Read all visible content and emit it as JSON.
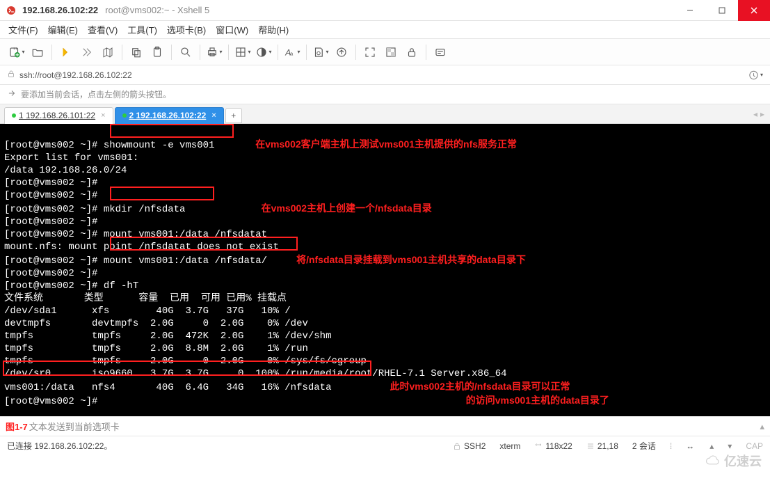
{
  "title": {
    "host": "192.168.26.102:22",
    "session": "root@vms002:~ - Xshell 5"
  },
  "menu": {
    "file": "文件(F)",
    "edit": "编辑(E)",
    "view": "查看(V)",
    "tools": "工具(T)",
    "tabs": "选项卡(B)",
    "window": "窗口(W)",
    "help": "帮助(H)"
  },
  "addr": {
    "url": "ssh://root@192.168.26.102:22"
  },
  "tip": {
    "text": "要添加当前会话，点击左侧的箭头按钮。"
  },
  "tabs": {
    "tab1_label": "1 192.168.26.101:22",
    "tab2_label": "2 192.168.26.102:22",
    "plus": "+"
  },
  "terminal": {
    "lines": [
      "[root@vms002 ~]# showmount -e vms001",
      "Export list for vms001:",
      "/data 192.168.26.0/24",
      "[root@vms002 ~]# ",
      "[root@vms002 ~]# ",
      "[root@vms002 ~]# mkdir /nfsdata",
      "[root@vms002 ~]# ",
      "[root@vms002 ~]# mount vms001:/data /nfsdatat",
      "mount.nfs: mount point /nfsdatat does not exist",
      "[root@vms002 ~]# mount vms001:/data /nfsdata/",
      "[root@vms002 ~]# ",
      "[root@vms002 ~]# df -hT",
      "文件系统       类型      容量  已用  可用 已用% 挂载点",
      "/dev/sda1      xfs        40G  3.7G   37G   10% /",
      "devtmpfs       devtmpfs  2.0G     0  2.0G    0% /dev",
      "tmpfs          tmpfs     2.0G  472K  2.0G    1% /dev/shm",
      "tmpfs          tmpfs     2.0G  8.8M  2.0G    1% /run",
      "tmpfs          tmpfs     2.0G     0  2.0G    0% /sys/fs/cgroup",
      "/dev/sr0       iso9660   3.7G  3.7G     0  100% /run/media/root/RHEL-7.1 Server.x86_64",
      "vms001:/data   nfs4       40G  6.4G   34G   16% /nfsdata",
      "[root@vms002 ~]# "
    ],
    "annotations": {
      "a1": "在vms002客户端主机上测试vms001主机提供的nfs服务正常",
      "a2": "在vms002主机上创建一个/nfsdata目录",
      "a3": "将/nfsdata目录挂载到vms001主机共享的data目录下",
      "a4": "此时vms002主机的/nfsdata目录可以正常",
      "a5": "的访问vms001主机的data目录了"
    },
    "df": {
      "headers": [
        "文件系统",
        "类型",
        "容量",
        "已用",
        "可用",
        "已用%",
        "挂载点"
      ],
      "rows": [
        {
          "fs": "/dev/sda1",
          "type": "xfs",
          "size": "40G",
          "used": "3.7G",
          "avail": "37G",
          "pct": "10%",
          "mount": "/"
        },
        {
          "fs": "devtmpfs",
          "type": "devtmpfs",
          "size": "2.0G",
          "used": "0",
          "avail": "2.0G",
          "pct": "0%",
          "mount": "/dev"
        },
        {
          "fs": "tmpfs",
          "type": "tmpfs",
          "size": "2.0G",
          "used": "472K",
          "avail": "2.0G",
          "pct": "1%",
          "mount": "/dev/shm"
        },
        {
          "fs": "tmpfs",
          "type": "tmpfs",
          "size": "2.0G",
          "used": "8.8M",
          "avail": "2.0G",
          "pct": "1%",
          "mount": "/run"
        },
        {
          "fs": "tmpfs",
          "type": "tmpfs",
          "size": "2.0G",
          "used": "0",
          "avail": "2.0G",
          "pct": "0%",
          "mount": "/sys/fs/cgroup"
        },
        {
          "fs": "/dev/sr0",
          "type": "iso9660",
          "size": "3.7G",
          "used": "3.7G",
          "avail": "0",
          "pct": "100%",
          "mount": "/run/media/root/RHEL-7.1 Server.x86_64"
        },
        {
          "fs": "vms001:/data",
          "type": "nfs4",
          "size": "40G",
          "used": "6.4G",
          "avail": "34G",
          "pct": "16%",
          "mount": "/nfsdata"
        }
      ]
    }
  },
  "input": {
    "placeholder": "文本发送到当前选项卡",
    "fig_label": "图1-7"
  },
  "status": {
    "connected": "已连接 192.168.26.102:22。",
    "proto": "SSH2",
    "term": "xterm",
    "size": "118x22",
    "pos": "21,18",
    "sessions": "2 会话",
    "cap": "CAP"
  },
  "colors": {
    "red": "#ff1f1f",
    "blue": "#3090e8",
    "close": "#e81123"
  },
  "watermark": "亿速云"
}
